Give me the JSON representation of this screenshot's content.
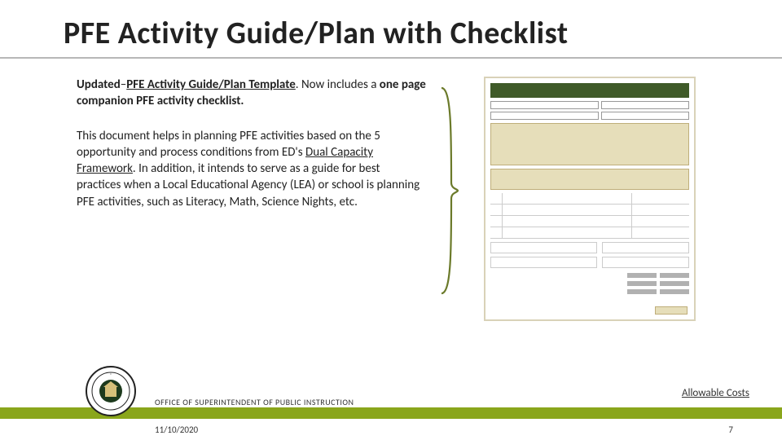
{
  "title": "PFE Activity Guide/Plan with Checklist",
  "para1": {
    "lead_bold": "Updated",
    "dash": "–",
    "link": "PFE Activity Guide/Plan Template",
    "period": ". ",
    "rest1": "Now includes a ",
    "bold_phrase": "one page companion PFE activity checklist."
  },
  "para2": {
    "t1": "This document helps in planning PFE activities based on the 5 opportunity and process conditions from ED's ",
    "link": "Dual Capacity Framework",
    "t2": ". In addition, it intends to serve as a guide for best practices when a Local Educational Agency (LEA) or school is planning PFE activities, such as Literacy, Math, Science Nights, etc."
  },
  "office": "OFFICE OF SUPERINTENDENT OF PUBLIC INSTRUCTION",
  "allowable": "Allowable Costs",
  "date": "11/10/2020",
  "page": "7"
}
